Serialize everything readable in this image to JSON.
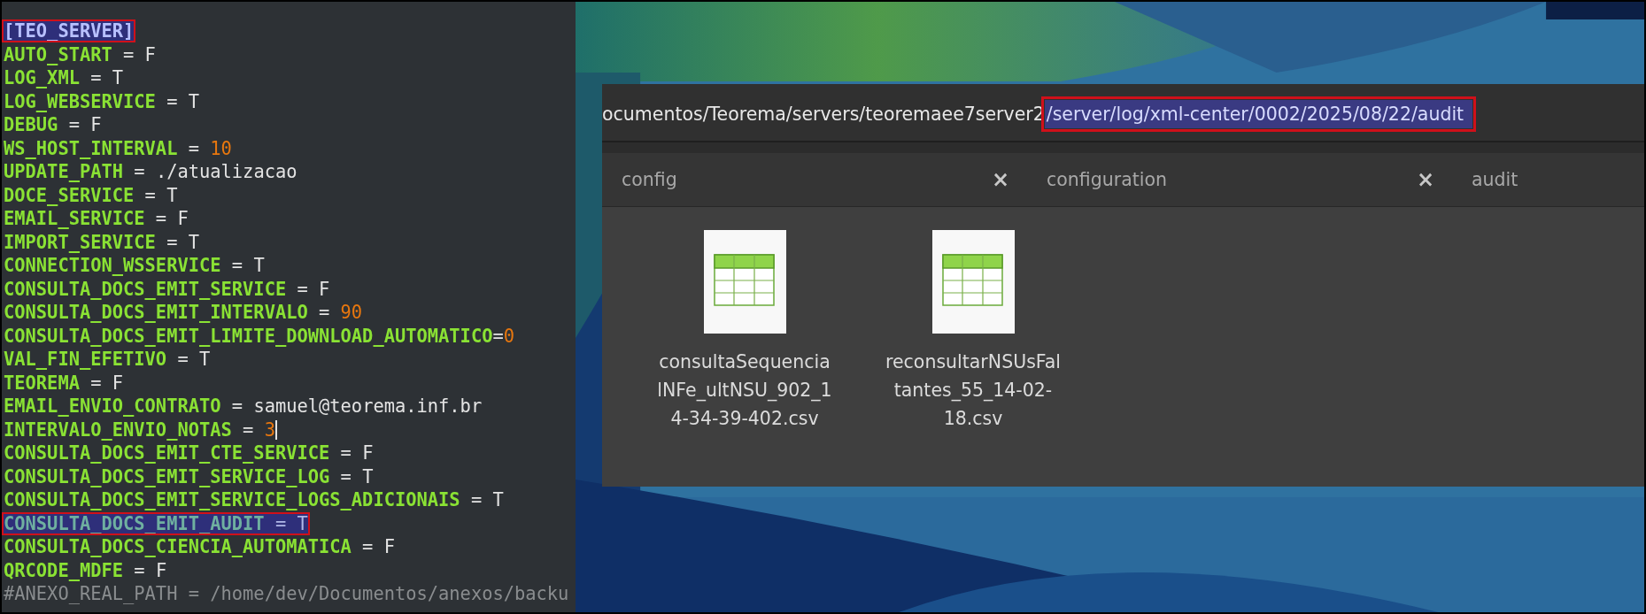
{
  "editor": {
    "lines": [
      {
        "kind": "section",
        "text": "[TEO_SERVER]",
        "highlighted": true
      },
      {
        "kind": "setting",
        "key": "AUTO_START",
        "op": " = ",
        "value": "F",
        "numeric": false,
        "highlighted": false
      },
      {
        "kind": "setting",
        "key": "LOG_XML",
        "op": " = ",
        "value": "T",
        "numeric": false,
        "highlighted": false
      },
      {
        "kind": "setting",
        "key": "LOG_WEBSERVICE",
        "op": " = ",
        "value": "T",
        "numeric": false,
        "highlighted": false
      },
      {
        "kind": "setting",
        "key": "DEBUG",
        "op": " = ",
        "value": "F",
        "numeric": false,
        "highlighted": false
      },
      {
        "kind": "setting",
        "key": "WS_HOST_INTERVAL",
        "op": " = ",
        "value": "10",
        "numeric": true,
        "highlighted": false
      },
      {
        "kind": "setting",
        "key": "UPDATE_PATH",
        "op": " = ",
        "value": "./atualizacao",
        "numeric": false,
        "highlighted": false
      },
      {
        "kind": "setting",
        "key": "DOCE_SERVICE",
        "op": " = ",
        "value": "T",
        "numeric": false,
        "highlighted": false
      },
      {
        "kind": "setting",
        "key": "EMAIL_SERVICE",
        "op": " = ",
        "value": "F",
        "numeric": false,
        "highlighted": false
      },
      {
        "kind": "setting",
        "key": "IMPORT_SERVICE",
        "op": " = ",
        "value": "T",
        "numeric": false,
        "highlighted": false
      },
      {
        "kind": "setting",
        "key": "CONNECTION_WSSERVICE",
        "op": " = ",
        "value": "T",
        "numeric": false,
        "highlighted": false
      },
      {
        "kind": "setting",
        "key": "CONSULTA_DOCS_EMIT_SERVICE",
        "op": " = ",
        "value": "F",
        "numeric": false,
        "highlighted": false
      },
      {
        "kind": "setting",
        "key": "CONSULTA_DOCS_EMIT_INTERVALO",
        "op": " = ",
        "value": "90",
        "numeric": true,
        "highlighted": false
      },
      {
        "kind": "setting",
        "key": "CONSULTA_DOCS_EMIT_LIMITE_DOWNLOAD_AUTOMATICO",
        "op": "=",
        "value": "0",
        "numeric": true,
        "highlighted": false
      },
      {
        "kind": "setting",
        "key": "VAL_FIN_EFETIVO",
        "op": " = ",
        "value": "T",
        "numeric": false,
        "highlighted": false
      },
      {
        "kind": "setting",
        "key": "TEOREMA",
        "op": " = ",
        "value": "F",
        "numeric": false,
        "highlighted": false
      },
      {
        "kind": "setting",
        "key": "EMAIL_ENVIO_CONTRATO",
        "op": " = ",
        "value": "samuel@teorema.inf.br",
        "numeric": false,
        "highlighted": false
      },
      {
        "kind": "setting",
        "key": "INTERVALO_ENVIO_NOTAS",
        "op": " = ",
        "value": "3",
        "numeric": true,
        "highlighted": false,
        "cursor": true
      },
      {
        "kind": "setting",
        "key": "CONSULTA_DOCS_EMIT_CTE_SERVICE",
        "op": " = ",
        "value": "F",
        "numeric": false,
        "highlighted": false
      },
      {
        "kind": "setting",
        "key": "CONSULTA_DOCS_EMIT_SERVICE_LOG",
        "op": " = ",
        "value": "T",
        "numeric": false,
        "highlighted": false
      },
      {
        "kind": "setting",
        "key": "CONSULTA_DOCS_EMIT_SERVICE_LOGS_ADICIONAIS",
        "op": " = ",
        "value": "T",
        "numeric": false,
        "highlighted": false
      },
      {
        "kind": "setting",
        "key": "CONSULTA_DOCS_EMIT_AUDIT",
        "op": " = ",
        "value": "T",
        "numeric": false,
        "highlighted": true
      },
      {
        "kind": "setting",
        "key": "CONSULTA_DOCS_CIENCIA_AUTOMATICA",
        "op": " = ",
        "value": "F",
        "numeric": false,
        "highlighted": false
      },
      {
        "kind": "setting",
        "key": "QRCODE_MDFE",
        "op": " = ",
        "value": "F",
        "numeric": false,
        "highlighted": false
      },
      {
        "kind": "comment",
        "text": "#ANEXO_REAL_PATH = /home/dev/Documentos/anexos/backu"
      }
    ]
  },
  "file_manager": {
    "path": [
      {
        "text": "ocumentos/Teorema/servers/teoremaee7server2",
        "selected": false
      },
      {
        "text": "/server/log/xml-center/0002/2025/08/22/audit",
        "selected": true
      }
    ],
    "tabs": [
      {
        "label": "config",
        "close": "×"
      },
      {
        "label": "configuration",
        "close": "×"
      },
      {
        "label": "audit"
      }
    ],
    "files": [
      {
        "name": "consultaSequencialNFe_ultNSU_902_14-34-39-402.csv"
      },
      {
        "name": "reconsultarNSUsFaltantes_55_14-02-18.csv"
      }
    ]
  }
}
